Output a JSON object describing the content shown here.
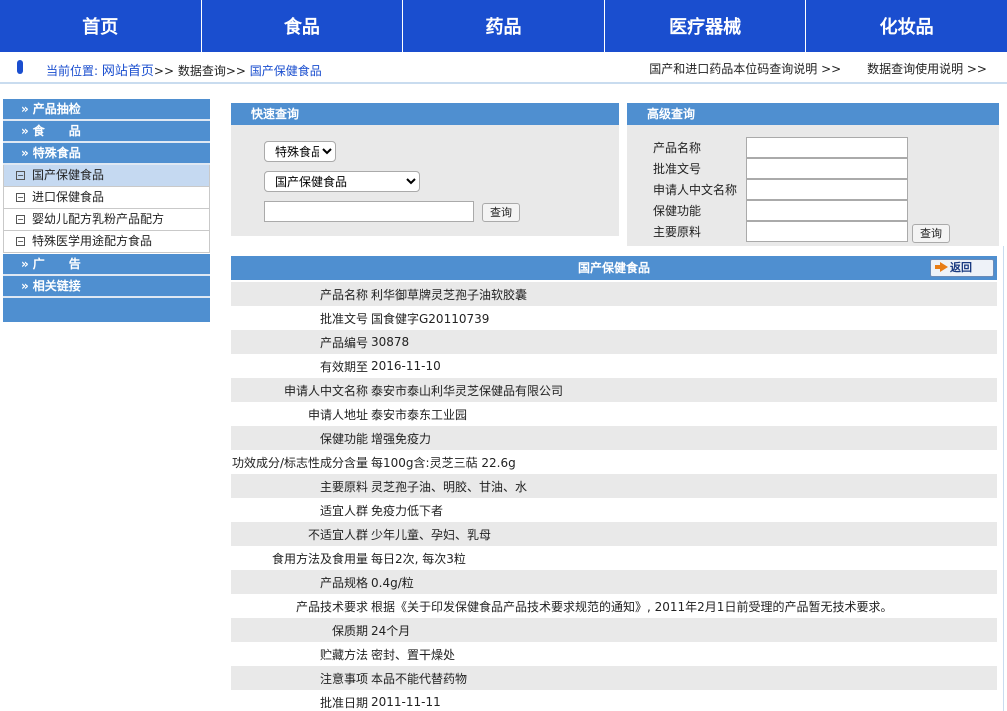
{
  "nav": {
    "items": [
      "首页",
      "食品",
      "药品",
      "医疗器械",
      "化妆品"
    ]
  },
  "breadcrumb": {
    "label": "当前位置:",
    "home": "网站首页",
    "sep1": ">>",
    "mid": "数据查询",
    "sep2": ">>",
    "current": "国产保健食品",
    "links": [
      "国产和进口药品本位码查询说明 >>",
      "数据查询使用说明 >>"
    ]
  },
  "sidebar": {
    "sections": [
      {
        "label": "产品抽检"
      },
      {
        "label": "食　　品"
      },
      {
        "label": "特殊食品"
      }
    ],
    "sub_items": [
      "国产保健食品",
      "进口保健食品",
      "婴幼儿配方乳粉产品配方",
      "特殊医学用途配方食品"
    ],
    "bottom_sections": [
      {
        "label": "广　　告"
      },
      {
        "label": "相关链接"
      }
    ],
    "arrow": "»",
    "box": "⊟"
  },
  "quick_query": {
    "title": "快速查询",
    "select1": "特殊食品",
    "select2": "国产保健食品",
    "input_value": "",
    "button": "查询"
  },
  "advanced_query": {
    "title": "高级查询",
    "fields": [
      "产品名称",
      "批准文号",
      "申请人中文名称",
      "保健功能",
      "主要原料"
    ],
    "button": "查询"
  },
  "detail": {
    "title": "国产保健食品",
    "back_label": "返回",
    "rows": [
      {
        "k": "产品名称",
        "v": "利华御草牌灵芝孢子油软胶囊"
      },
      {
        "k": "批准文号",
        "v": "国食健字G20110739"
      },
      {
        "k": "产品编号",
        "v": "30878"
      },
      {
        "k": "有效期至",
        "v": "2016-11-10"
      },
      {
        "k": "申请人中文名称",
        "v": "泰安市泰山利华灵芝保健品有限公司"
      },
      {
        "k": "申请人地址",
        "v": "泰安市泰东工业园"
      },
      {
        "k": "保健功能",
        "v": "增强免疫力"
      },
      {
        "k": "功效成分/标志性成分含量",
        "v": "每100g含:灵芝三萜 22.6g"
      },
      {
        "k": "主要原料",
        "v": "灵芝孢子油、明胶、甘油、水"
      },
      {
        "k": "适宜人群",
        "v": "免疫力低下者"
      },
      {
        "k": "不适宜人群",
        "v": "少年儿童、孕妇、乳母"
      },
      {
        "k": "食用方法及食用量",
        "v": "每日2次, 每次3粒"
      },
      {
        "k": "产品规格",
        "v": "0.4g/粒"
      },
      {
        "k": "产品技术要求",
        "v": "根据《关于印发保健食品产品技术要求规范的通知》, 2011年2月1日前受理的产品暂无技术要求。"
      },
      {
        "k": "保质期",
        "v": "24个月"
      },
      {
        "k": "贮藏方法",
        "v": "密封、置干燥处"
      },
      {
        "k": "注意事项",
        "v": "本品不能代替药物"
      },
      {
        "k": "批准日期",
        "v": "2011-11-11"
      }
    ]
  },
  "colors": {
    "nav_bg": "#1a4ecf",
    "header_bg": "#4f8fd0",
    "row_alt": "#e9e9e9",
    "active_item": "#c5d9f1"
  }
}
